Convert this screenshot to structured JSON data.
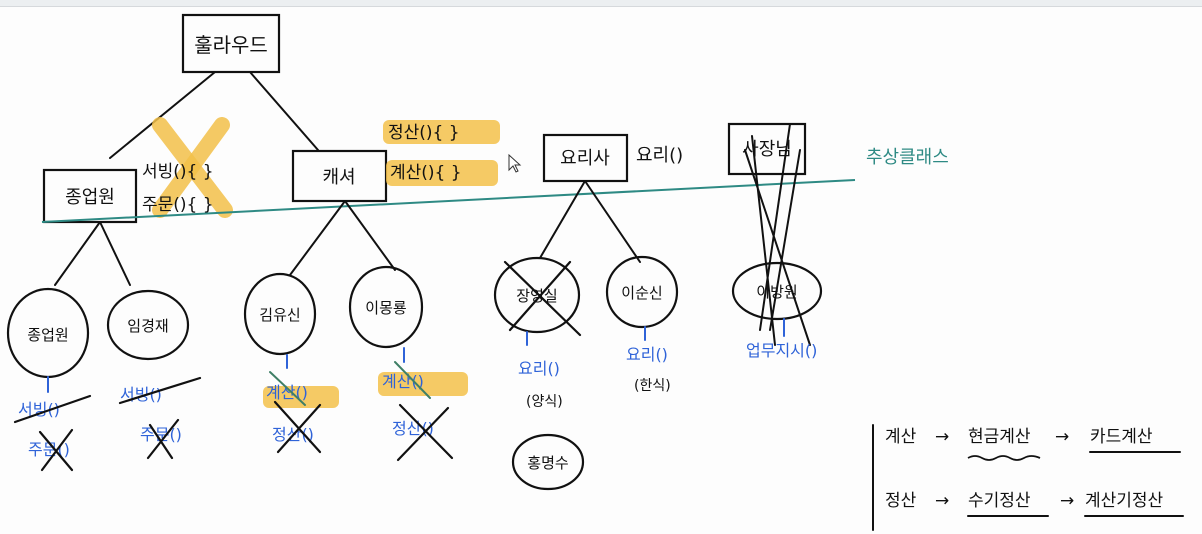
{
  "nodes": {
    "root": "훌라우드",
    "manager": "종업원",
    "cashier": "캐셔",
    "cook": "요리사",
    "owner": "사장님"
  },
  "methods": {
    "manager_serve": "서빙(){ }",
    "manager_order": "주문(){ }",
    "cashier_settle": "정산(){ }",
    "cashier_calc": "계산(){ }",
    "cook_cook": "요리()"
  },
  "abstract_label": "추상클래스",
  "employees": {
    "manager_1": "종업원",
    "manager_2": "임경재",
    "cashier_1": "김유신",
    "cashier_2": "이몽룡",
    "cook_1": "장영실",
    "cook_2": "이순신",
    "owner_1": "이방원",
    "extra_cook": "홍명수"
  },
  "employee_methods": {
    "m1_a": "서빙()",
    "m1_b": "주문()",
    "m2_a": "서빙()",
    "m2_b": "주문()",
    "c1_a": "계산()",
    "c1_b": "정산()",
    "c2_a": "계산()",
    "c2_b": "정산()",
    "k1": "요리()",
    "k1_note": "(양식)",
    "k2": "요리()",
    "k2_note": "(한식)",
    "o1": "업무지시()"
  },
  "notes": {
    "line1_a": "계산",
    "line1_b": "현금계산",
    "line1_c": "카드계산",
    "line2_a": "정산",
    "line2_b": "수기정산",
    "line2_c": "계산기정산",
    "arrow": "→"
  }
}
